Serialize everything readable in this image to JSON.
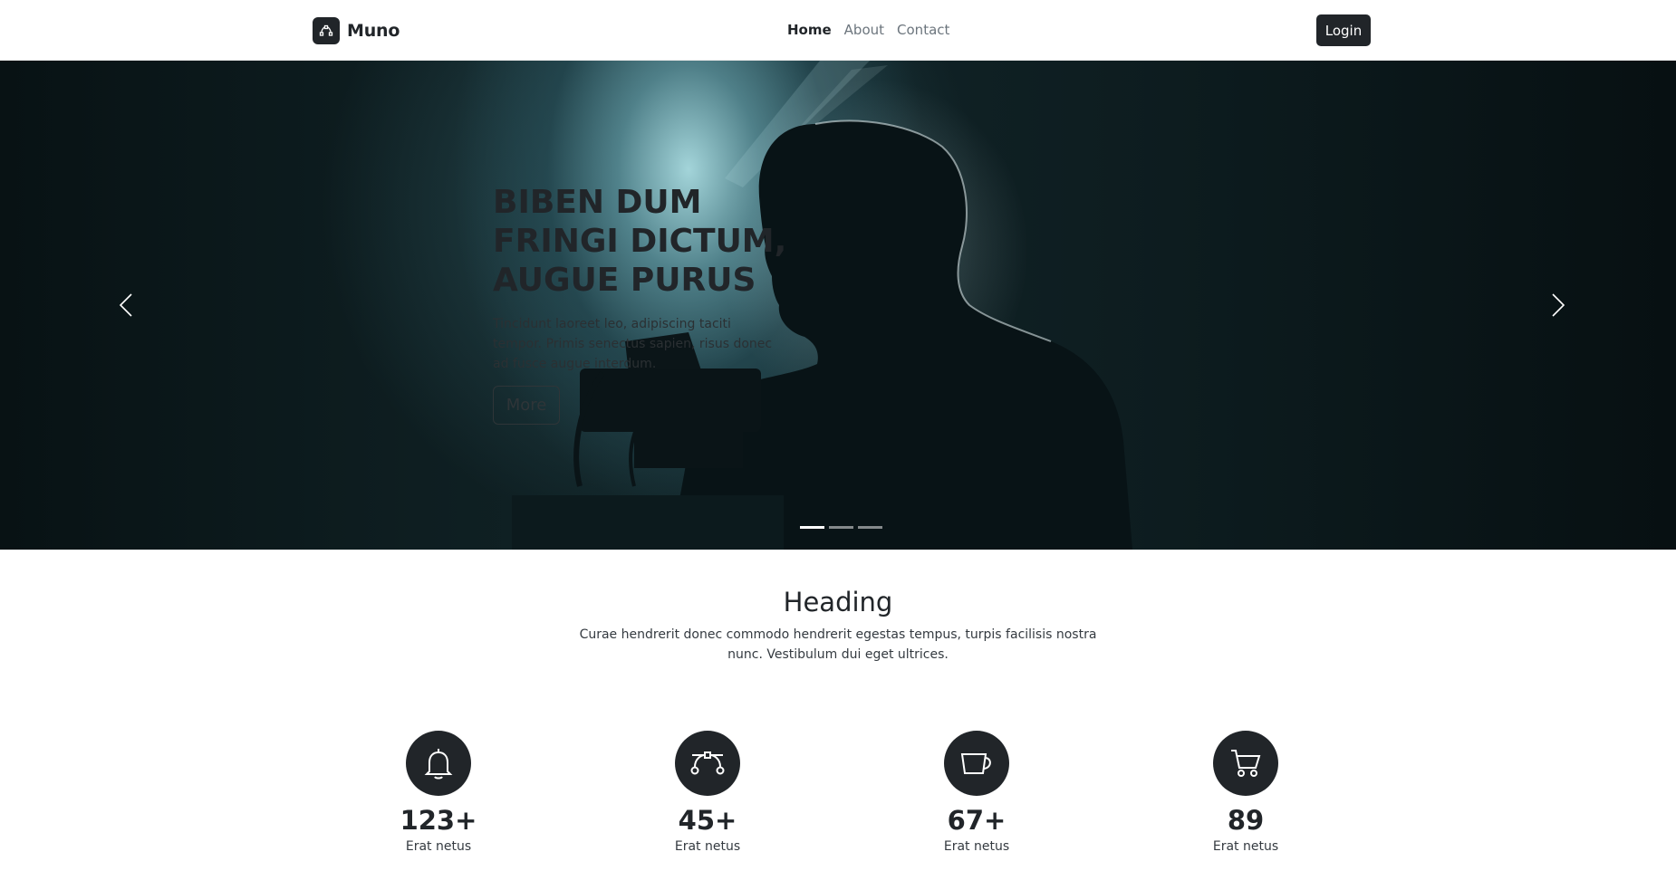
{
  "navbar": {
    "brand": "Muno",
    "brand_icon": "bezier-curve-icon",
    "links": [
      {
        "label": "Home",
        "active": true
      },
      {
        "label": "About",
        "active": false
      },
      {
        "label": "Contact",
        "active": false
      }
    ],
    "login_label": "Login"
  },
  "hero": {
    "title": "BIBEN DUM FRINGI DICTUM, AUGUE PURUS",
    "text": "Tincidunt laoreet leo, adipiscing taciti tempor. Primis senectus sapien, risus donec ad fusce augue interdum.",
    "button_label": "More",
    "slide_count": 3,
    "active_slide": 1,
    "prev_icon": "chevron-left-icon",
    "next_icon": "chevron-right-icon"
  },
  "features": {
    "heading": "Heading",
    "lead": "Curae hendrerit donec commodo hendrerit egestas tempus, turpis facilisis nostra nunc. Vestibulum dui eget ultrices.",
    "stats": [
      {
        "icon": "bell-icon",
        "value": "123+",
        "label": "Erat netus"
      },
      {
        "icon": "bezier-curve-icon",
        "value": "45+",
        "label": "Erat netus"
      },
      {
        "icon": "cup-icon",
        "value": "67+",
        "label": "Erat netus"
      },
      {
        "icon": "cart-icon",
        "value": "89",
        "label": "Erat netus"
      }
    ]
  },
  "colors": {
    "dark": "#212529",
    "muted": "#6c757d",
    "hero_glow": "#9fd4d9"
  }
}
